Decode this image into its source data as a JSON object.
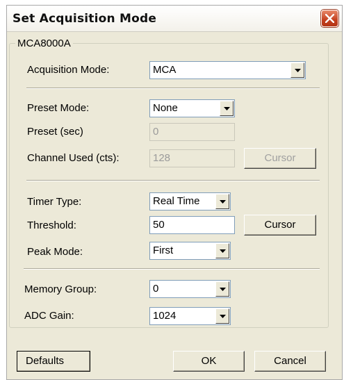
{
  "window": {
    "title": "Set Acquisition Mode",
    "close_icon": "close-icon"
  },
  "group": {
    "label": "MCA8000A"
  },
  "acquisition_mode": {
    "label": "Acquisition Mode:",
    "value": "MCA"
  },
  "preset_mode": {
    "label": "Preset Mode:",
    "value": "None"
  },
  "preset": {
    "label": "Preset (sec)",
    "value": "0"
  },
  "channel_used": {
    "label": "Channel Used (cts):",
    "value": "128",
    "cursor_label": "Cursor"
  },
  "timer_type": {
    "label": "Timer Type:",
    "value": "Real Time"
  },
  "threshold": {
    "label": "Threshold:",
    "value": "50",
    "cursor_label": "Cursor"
  },
  "peak_mode": {
    "label": "Peak Mode:",
    "value": "First"
  },
  "memory_group": {
    "label": "Memory Group:",
    "value": "0"
  },
  "adc_gain": {
    "label": "ADC Gain:",
    "value": "1024"
  },
  "buttons": {
    "defaults": "Defaults",
    "ok": "OK",
    "cancel": "Cancel"
  }
}
